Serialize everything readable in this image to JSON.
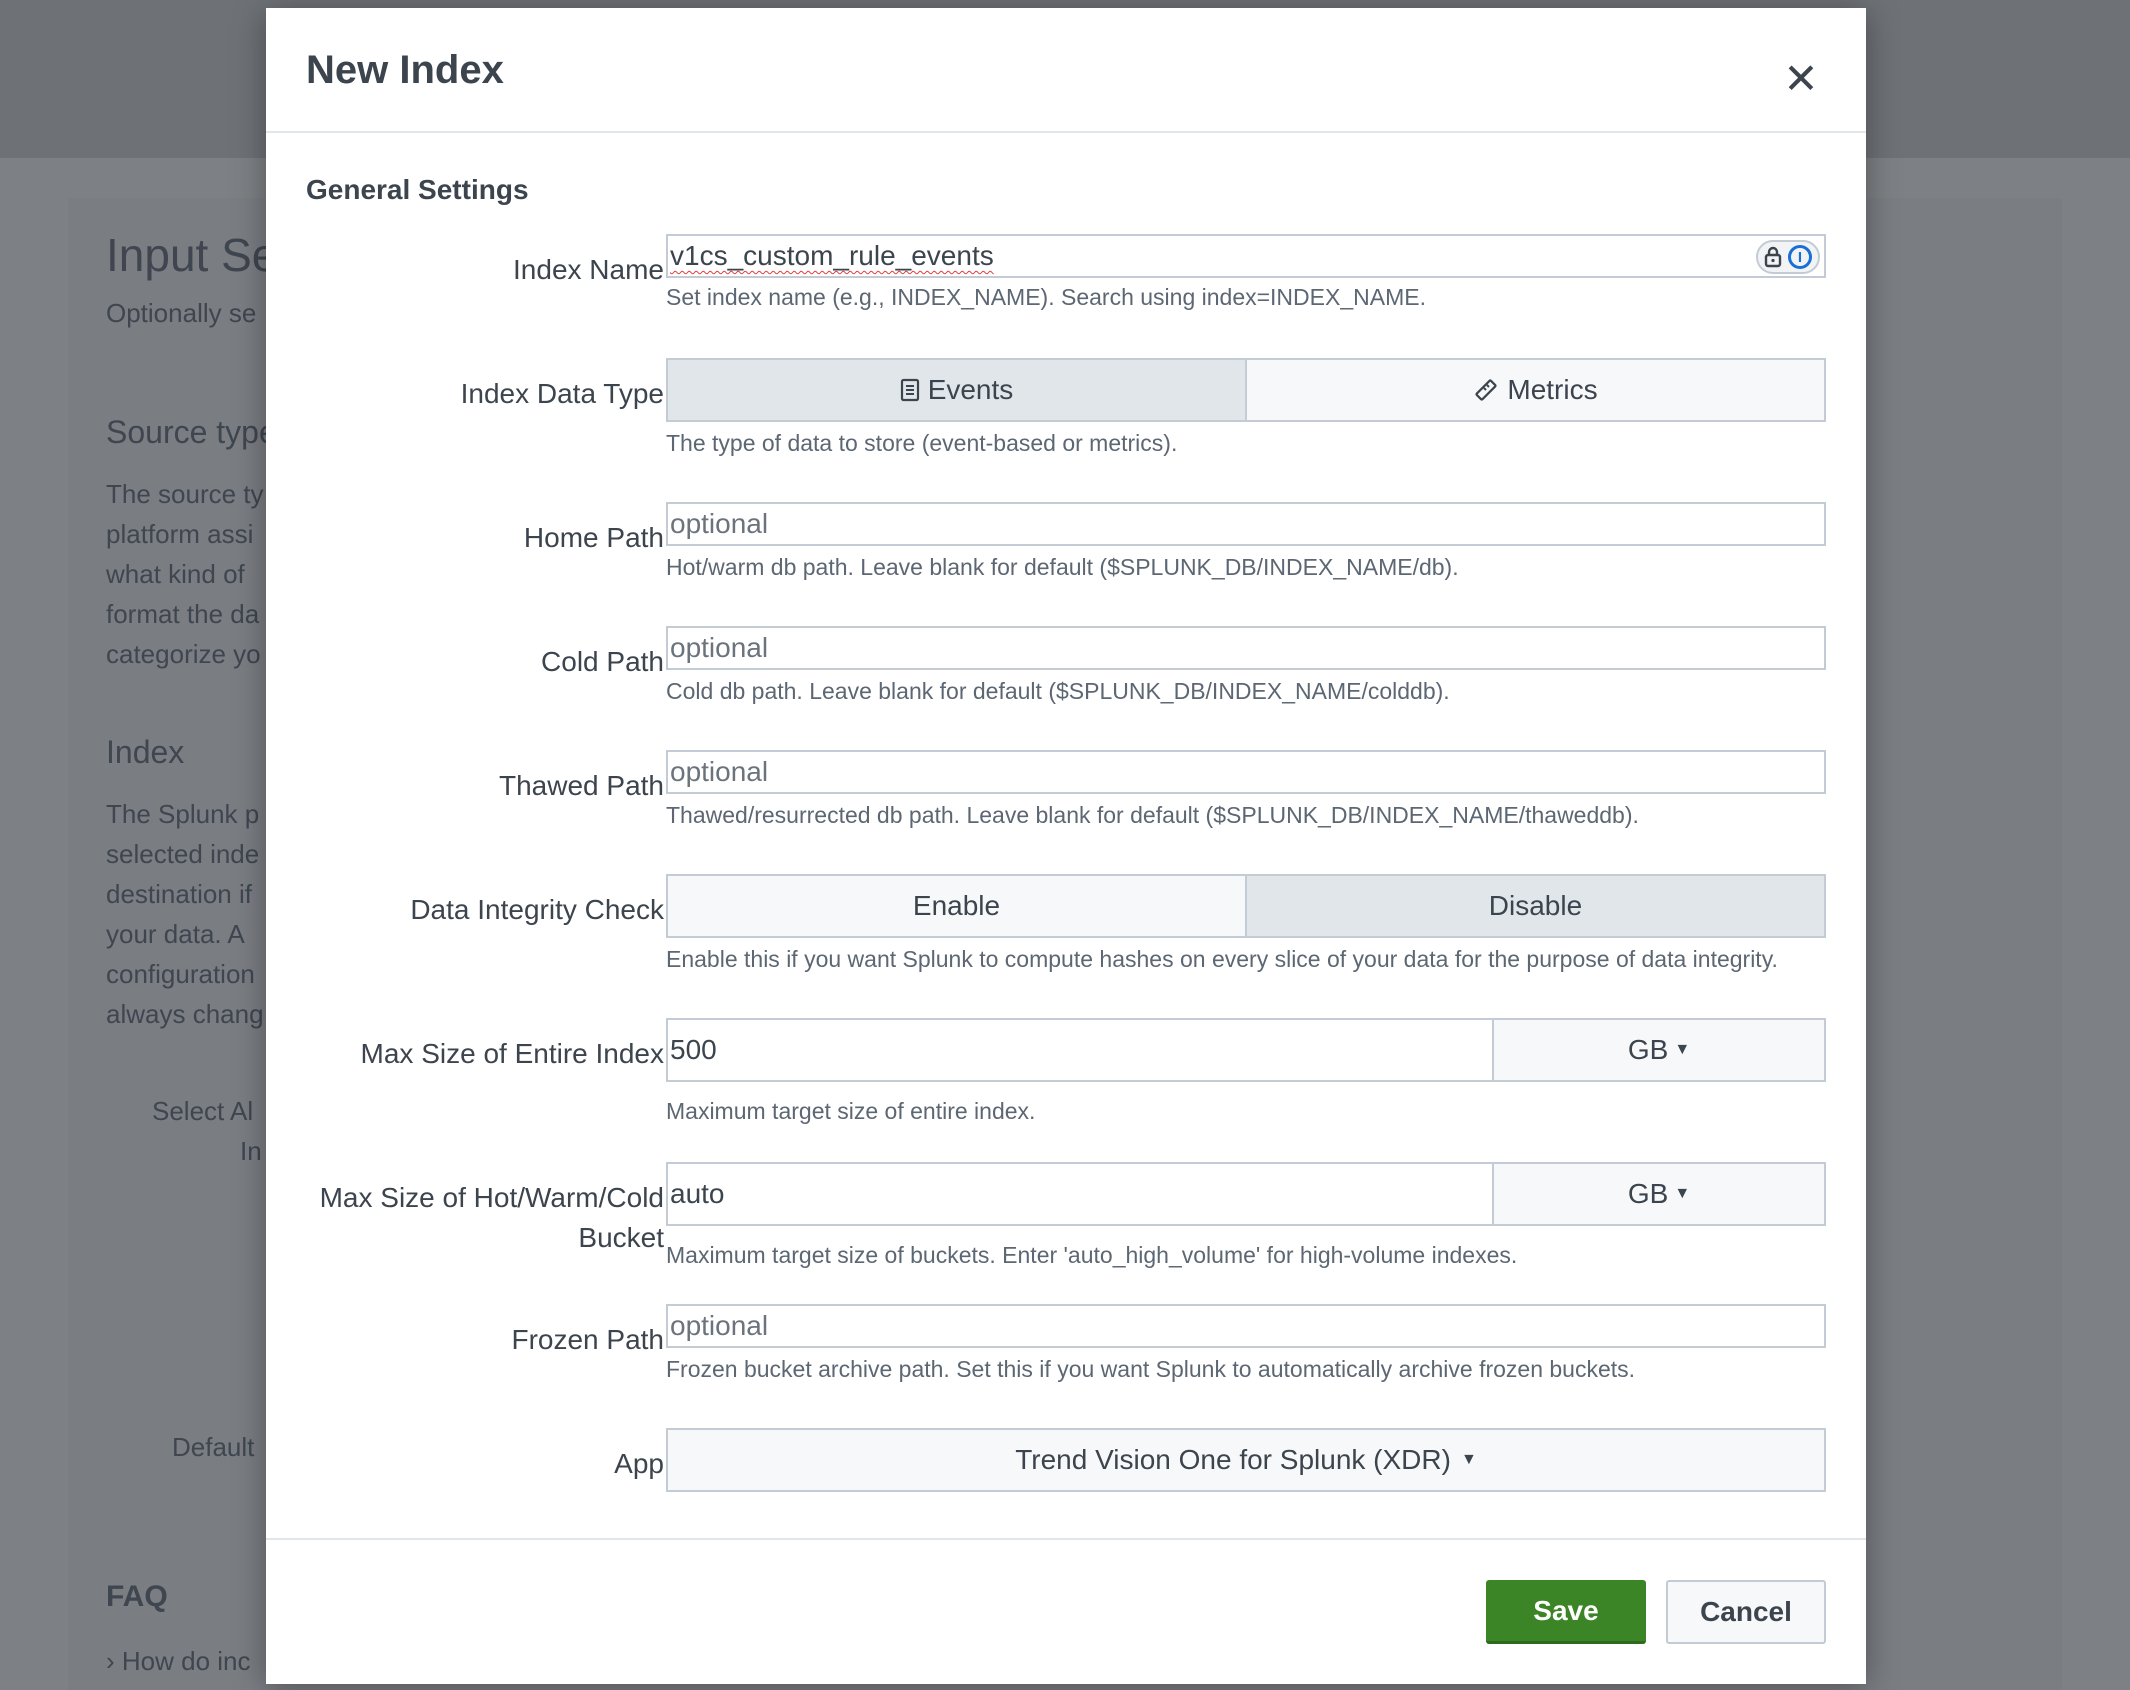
{
  "background": {
    "title": "Input Se",
    "subtitle": "Optionally se",
    "source_type_heading": "Source type",
    "source_type_text": [
      "The source ty",
      "platform assi",
      "what kind of",
      "format the da",
      "categorize yo"
    ],
    "index_heading": "Index",
    "index_text": [
      "The Splunk p",
      "selected inde",
      "destination if",
      "your data. A",
      "configuration",
      "always chang"
    ],
    "select_all": "Select Al",
    "select_all_2": "In",
    "default_label": "Default",
    "faq_heading": "FAQ",
    "faq_item": "How do inc"
  },
  "modal": {
    "title": "New Index",
    "close_icon": "close-icon",
    "section_title": "General Settings",
    "fields": {
      "index_name": {
        "label": "Index Name",
        "value": "v1cs_custom_rule_events",
        "help": "Set index name (e.g., INDEX_NAME). Search using index=INDEX_NAME."
      },
      "index_data_type": {
        "label": "Index Data Type",
        "options": [
          "Events",
          "Metrics"
        ],
        "selected": "Events",
        "help": "The type of data to store (event-based or metrics)."
      },
      "home_path": {
        "label": "Home Path",
        "placeholder": "optional",
        "help": "Hot/warm db path. Leave blank for default ($SPLUNK_DB/INDEX_NAME/db)."
      },
      "cold_path": {
        "label": "Cold Path",
        "placeholder": "optional",
        "help": "Cold db path. Leave blank for default ($SPLUNK_DB/INDEX_NAME/colddb)."
      },
      "thawed_path": {
        "label": "Thawed Path",
        "placeholder": "optional",
        "help": "Thawed/resurrected db path. Leave blank for default ($SPLUNK_DB/INDEX_NAME/thaweddb)."
      },
      "data_integrity": {
        "label": "Data Integrity Check",
        "options": [
          "Enable",
          "Disable"
        ],
        "selected": "Disable",
        "help": "Enable this if you want Splunk to compute hashes on every slice of your data for the purpose of data integrity."
      },
      "max_size_index": {
        "label": "Max Size of Entire Index",
        "value": "500",
        "unit": "GB",
        "help": "Maximum target size of entire index."
      },
      "max_size_bucket": {
        "label_line1": "Max Size of Hot/Warm/Cold",
        "label_line2": "Bucket",
        "value": "auto",
        "unit": "GB",
        "help": "Maximum target size of buckets. Enter 'auto_high_volume' for high-volume indexes."
      },
      "frozen_path": {
        "label": "Frozen Path",
        "placeholder": "optional",
        "help": "Frozen bucket archive path. Set this if you want Splunk to automatically archive frozen buckets."
      },
      "app": {
        "label": "App",
        "value": "Trend Vision One for Splunk (XDR)"
      }
    },
    "buttons": {
      "save": "Save",
      "cancel": "Cancel"
    }
  },
  "colors": {
    "save_green": "#3c8527",
    "overlay": "#7d8084",
    "border": "#c3cbd4"
  }
}
